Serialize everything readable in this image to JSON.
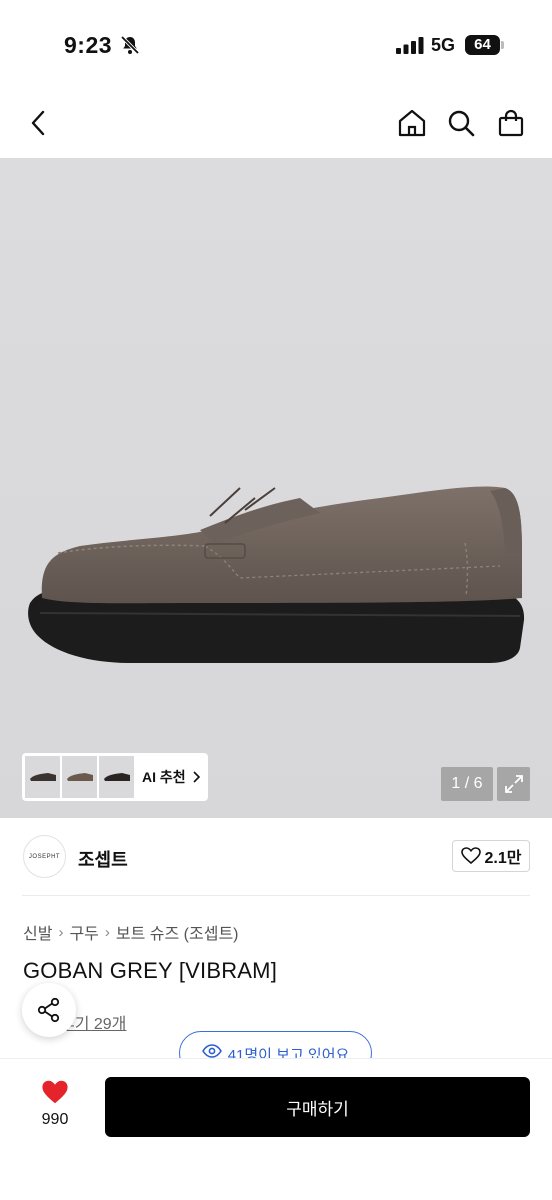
{
  "status": {
    "time": "9:23",
    "network": "5G",
    "battery": "64"
  },
  "nav": {
    "back": "back-icon",
    "home": "home-icon",
    "search": "search-icon",
    "cart": "bag-icon"
  },
  "gallery": {
    "counter": "1 / 6",
    "ai_label": "AI 추천"
  },
  "brand": {
    "logo_text": "JOSEPHT",
    "name": "조셉트",
    "likes": "2.1만"
  },
  "breadcrumb": [
    "신발",
    "구두",
    "보트 슈즈 (조셉트)"
  ],
  "product": {
    "title": "GOBAN GREY [VIBRAM]",
    "review_text": "후기 29개",
    "viewers": "41명이 보고 있어요"
  },
  "bottom": {
    "wish_count": "990",
    "buy_label": "구매하기"
  },
  "colors": {
    "accent_blue": "#2c5fd0",
    "heart_red": "#e5232a",
    "buy_bg": "#000000"
  }
}
